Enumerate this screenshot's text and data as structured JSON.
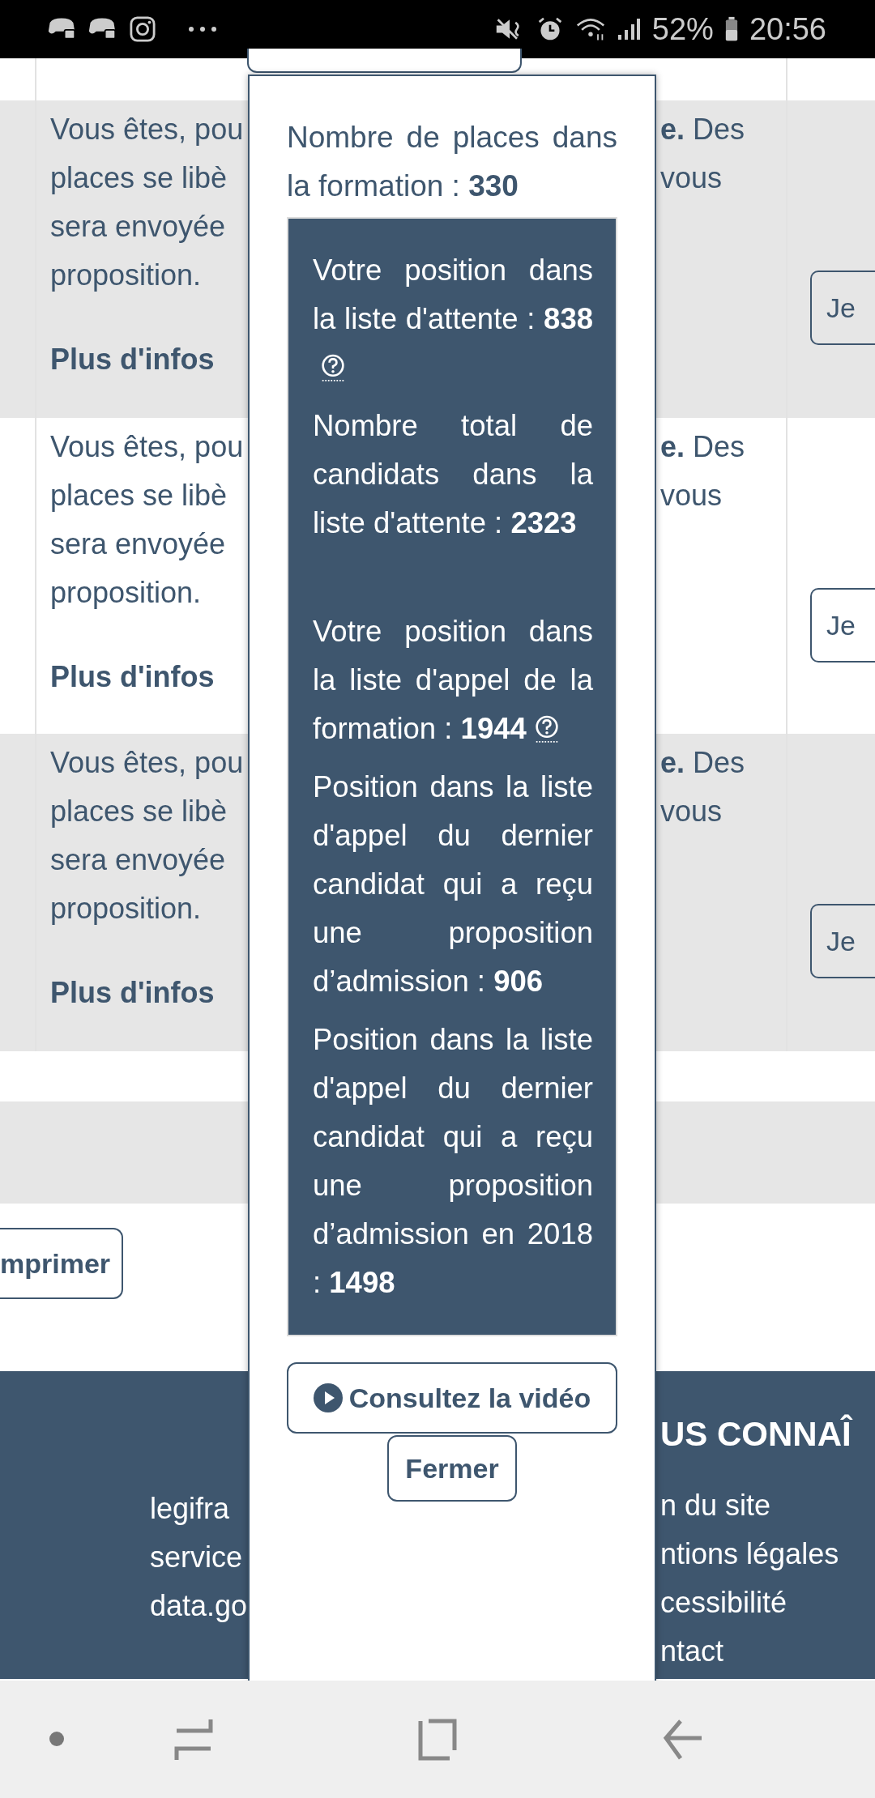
{
  "status_bar": {
    "battery": "52%",
    "time": "20:56"
  },
  "table": {
    "rows": [
      {
        "left_lines": [
          "Vous êtes, pou",
          "places se libè",
          "sera envoyée",
          "proposition."
        ],
        "link": "Plus d'infos",
        "right_lines": [
          "**e.** Des",
          "vous"
        ],
        "button": "Je"
      },
      {
        "left_lines": [
          "Vous êtes, pou",
          "places se libè",
          "sera envoyée",
          "proposition."
        ],
        "link": "Plus d'infos",
        "right_lines": [
          "**e.** Des",
          "vous"
        ],
        "button": "Je"
      },
      {
        "left_lines": [
          "Vous êtes, pou",
          "places se libè",
          "sera envoyée",
          "proposition."
        ],
        "link": "Plus d'infos",
        "right_lines": [
          "**e.** Des",
          "vous"
        ],
        "button": "Je"
      }
    ]
  },
  "print_button": "mprimer",
  "footer": {
    "heading": "US CONNAÎ",
    "left_links": [
      "legifra",
      "service",
      "data.go"
    ],
    "right_links": [
      "n du site",
      "ntions légales",
      "cessibilité",
      "ntact"
    ]
  },
  "popup": {
    "places": "Nombre de places dans la formation : **330**",
    "waitlist": [
      {
        "text": "Votre position dans la liste d'attente : **838**",
        "help": true
      },
      {
        "text": "Nombre total de candidats dans la liste d'attente : **2323**",
        "help": false
      }
    ],
    "call_list": [
      {
        "text": "Votre position dans la liste d'appel de la formation : **1944**",
        "help": true
      },
      {
        "text": "Position dans la liste d'appel du dernier candidat qui a reçu une proposition d’admission : **906**",
        "help": false
      },
      {
        "text": "Position dans la liste d'appel du dernier candidat qui a reçu une proposition d’admission en 2018 : **1498**",
        "help": false
      }
    ],
    "video_button": "Consultez la vidéo",
    "close_button": "Fermer"
  }
}
